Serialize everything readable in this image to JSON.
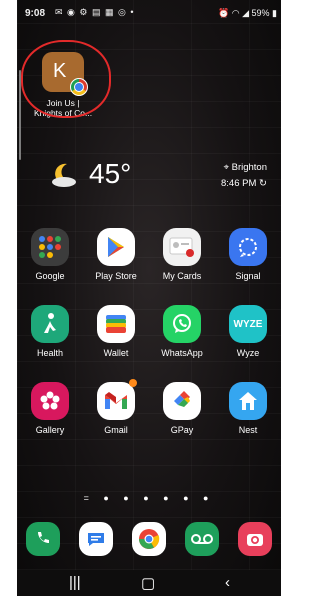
{
  "status_bar": {
    "time": "9:08",
    "left_icons": [
      "mail",
      "chat",
      "settings-gear",
      "message",
      "board",
      "stop-icon",
      "dot"
    ],
    "battery": "59%"
  },
  "pinned_shortcut": {
    "tile_letter": "K",
    "label_line1": "Join Us |",
    "label_line2": "Knights of Co..."
  },
  "weather": {
    "temperature": "45°",
    "location": "Brighton",
    "time": "8:46 PM"
  },
  "apps": [
    {
      "name": "Google"
    },
    {
      "name": "Play Store"
    },
    {
      "name": "My Cards"
    },
    {
      "name": "Signal"
    },
    {
      "name": "Health"
    },
    {
      "name": "Wallet"
    },
    {
      "name": "WhatsApp"
    },
    {
      "name": "Wyze"
    },
    {
      "name": "Gallery"
    },
    {
      "name": "Gmail"
    },
    {
      "name": "GPay"
    },
    {
      "name": "Nest"
    }
  ],
  "page_indicator": "= ● ● ● ● ● ●",
  "dock": [
    "Phone",
    "Messages",
    "Chrome",
    "Voicemail",
    "Camera"
  ],
  "colors": {
    "highlight_circle": "#e32a2a",
    "badge": "#ff8a1a"
  }
}
